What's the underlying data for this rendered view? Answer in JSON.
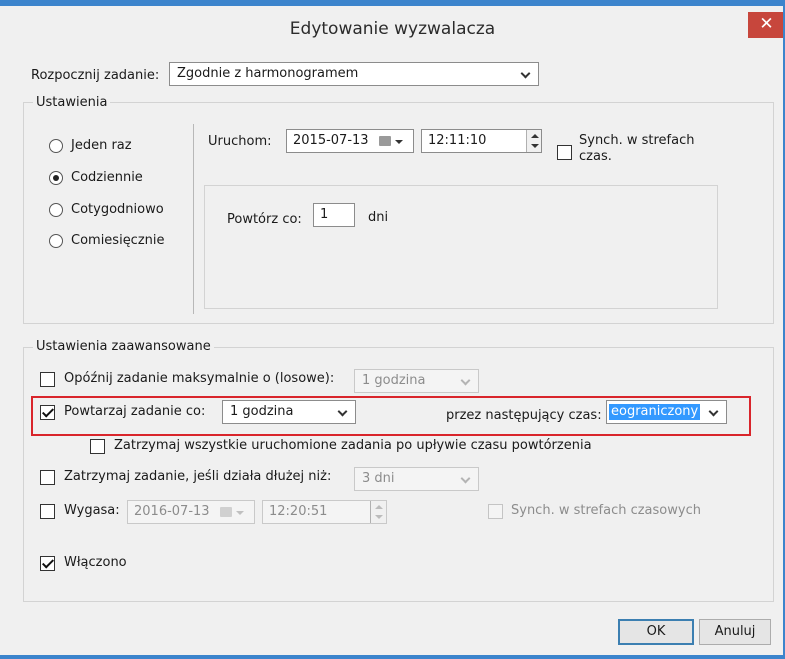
{
  "window": {
    "title": "Edytowanie wyzwalacza",
    "close_glyph": "✕"
  },
  "begin_task": {
    "label": "Rozpocznij zadanie:",
    "value": "Zgodnie z harmonogramem"
  },
  "settings": {
    "legend": "Ustawienia",
    "radios": [
      {
        "label": "Jeden raz",
        "selected": false
      },
      {
        "label": "Codziennie",
        "selected": true
      },
      {
        "label": "Cotygodniowo",
        "selected": false
      },
      {
        "label": "Comiesięcznie",
        "selected": false
      }
    ],
    "start_label": "Uruchom:",
    "start_date": "2015-07-13",
    "start_time": "12:11:10",
    "sync_label_line1": "Synch. w strefach",
    "sync_label_line2": "czas.",
    "sync_checked": false,
    "repeat_every_label": "Powtórz co:",
    "repeat_every_value": "1",
    "repeat_every_unit": "dni"
  },
  "advanced": {
    "legend": "Ustawienia zaawansowane",
    "delay": {
      "label": "Opóźnij zadanie maksymalnie o (losowe):",
      "checked": false,
      "value": "1 godzina"
    },
    "repeat": {
      "label": "Powtarzaj zadanie co:",
      "checked": true,
      "value": "1 godzina",
      "duration_label": "przez następujący czas:",
      "duration_value": "eograniczony"
    },
    "stop_all": {
      "label": "Zatrzymaj wszystkie uruchomione zadania po upływie czasu powtórzenia",
      "checked": false
    },
    "stop_if": {
      "label": "Zatrzymaj zadanie, jeśli działa dłużej niż:",
      "checked": false,
      "value": "3 dni"
    },
    "expire": {
      "label": "Wygasa:",
      "checked": false,
      "date": "2016-07-13",
      "time": "12:20:51",
      "sync_label": "Synch. w strefach czasowych",
      "sync_checked": false
    },
    "enabled": {
      "label": "Włączono",
      "checked": true
    }
  },
  "buttons": {
    "ok": "OK",
    "cancel": "Anuluj"
  },
  "colors": {
    "title_accent": "#3c84cc",
    "close": "#c7463c",
    "highlight": "#d9252b",
    "selection": "#3399ff"
  }
}
